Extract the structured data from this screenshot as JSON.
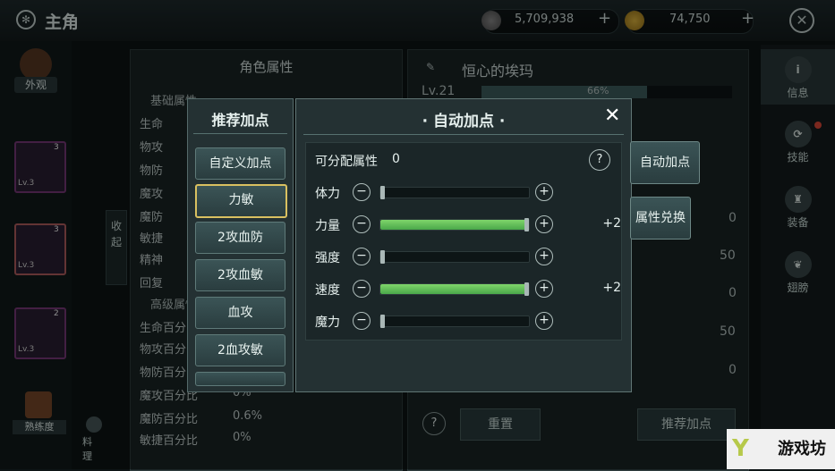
{
  "header": {
    "title": "主角",
    "silver": "5,709,938",
    "gold": "74,750"
  },
  "left": {
    "appearance_label": "外观",
    "slots": [
      {
        "level": "Lv.3",
        "stars": "3"
      },
      {
        "level": "Lv.3",
        "stars": "3"
      },
      {
        "level": "Lv.3",
        "stars": "2"
      }
    ],
    "proficiency_label": "熟练度",
    "cooking_label": "料理",
    "collapse_label": "收起"
  },
  "attrs_panel": {
    "title": "角色属性",
    "basic_header": "基础属性",
    "stats": [
      "生命",
      "物攻",
      "物防",
      "魔攻",
      "魔防",
      "敏捷",
      "精神",
      "回复"
    ],
    "advanced_header": "高级属性",
    "adv_stats": [
      {
        "label": "生命百分比",
        "value": ""
      },
      {
        "label": "物攻百分比",
        "value": ""
      },
      {
        "label": "物防百分比",
        "value": ""
      },
      {
        "label": "魔攻百分比",
        "value": "0%"
      },
      {
        "label": "魔防百分比",
        "value": "0.6%"
      },
      {
        "label": "敏捷百分比",
        "value": "0%"
      }
    ]
  },
  "character": {
    "name": "恒心的埃玛",
    "level": "Lv.21",
    "exp": "66%",
    "right_values": [
      "0",
      "50",
      "0",
      "50",
      "0"
    ],
    "reset_label": "重置",
    "recommend_label": "推荐加点"
  },
  "right_rail": {
    "items": [
      "信息",
      "技能",
      "装备",
      "翅膀"
    ]
  },
  "recommend_panel": {
    "title": "推荐加点",
    "options": [
      "自定义加点",
      "力敏",
      "2攻血防",
      "2攻血敏",
      "血攻",
      "2血攻敏"
    ]
  },
  "auto_panel": {
    "title": "· 自动加点 ·",
    "available_label": "可分配属性",
    "available_value": "0",
    "help": "?",
    "rows": [
      {
        "label": "体力",
        "fill": 0,
        "delta": ""
      },
      {
        "label": "力量",
        "fill": 1,
        "delta": "+2"
      },
      {
        "label": "强度",
        "fill": 0,
        "delta": ""
      },
      {
        "label": "速度",
        "fill": 1,
        "delta": "+2"
      },
      {
        "label": "魔力",
        "fill": 0,
        "delta": ""
      }
    ],
    "tabs": [
      "自动加点",
      "属性兑换"
    ]
  },
  "watermark": "游戏坊"
}
